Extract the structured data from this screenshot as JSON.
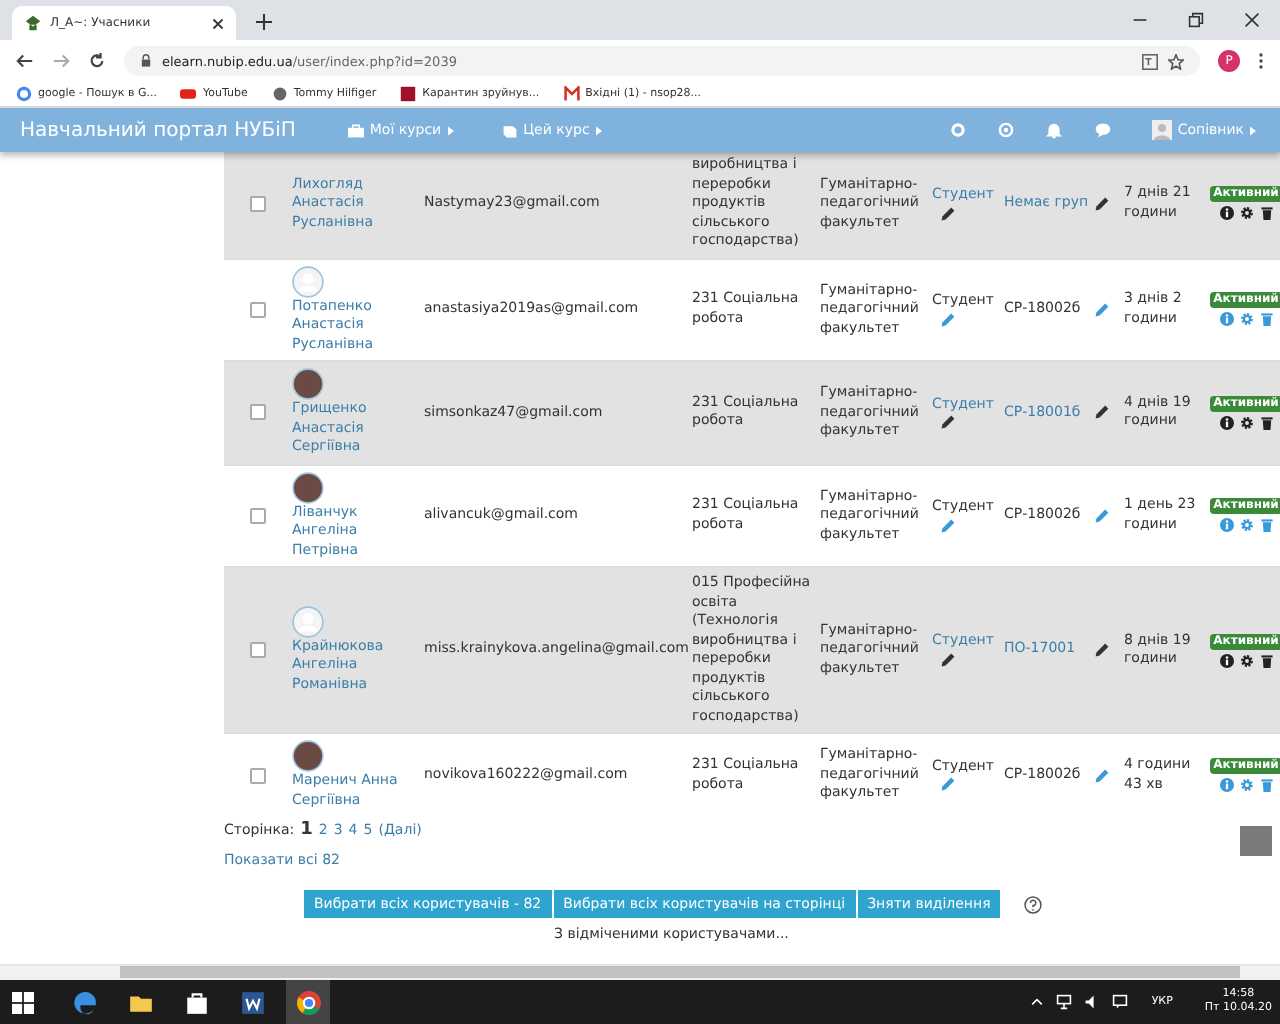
{
  "browser": {
    "tab_title": "Л_А~: Учасники",
    "url_host": "elearn.nubip.edu.ua",
    "url_path": "/user/index.php?id=2039",
    "avatar_letter": "P",
    "bookmarks": [
      {
        "label": "google - Пошук в G...",
        "kind": "google"
      },
      {
        "label": "YouTube",
        "kind": "youtube"
      },
      {
        "label": "Tommy Hilfiger",
        "kind": "globe"
      },
      {
        "label": "Карантин зруйнув...",
        "kind": "news"
      },
      {
        "label": "Вхідні (1) - nsop28...",
        "kind": "mail"
      }
    ]
  },
  "navbar": {
    "brand": "Навчальний портал НУБіП",
    "menus": [
      {
        "label": "Мої курси",
        "kind": "briefcase"
      },
      {
        "label": "Цей курс",
        "kind": "book"
      }
    ],
    "user": "Сопівник"
  },
  "rows": [
    {
      "name": "Лихогляд Анастасія Русланівна",
      "checked": false,
      "email": "Nastymay23@gmail.com",
      "specialty": "виробництва і переробки продуктів сільського господарства)",
      "faculty": "Гуманітарно- педагогічний факультет",
      "role": "Студент",
      "group": "Немає груп",
      "last_access": "7 днів 21 години",
      "status": "Активний"
    },
    {
      "name": "Потапенко Анастасія Русланівна",
      "kind": "default",
      "checked": false,
      "email": "anastasiya2019as@gmail.com",
      "specialty": "231 Соціальна робота",
      "faculty": "Гуманітарно- педагогічний факультет",
      "role": "Студент",
      "group": "СР-18002б",
      "last_access": "3 днів 2 години",
      "status": "Активний"
    },
    {
      "name": "Грищенко Анастасія Сергіївна",
      "kind": "photo",
      "checked": false,
      "email": "simsonkaz47@gmail.com",
      "specialty": "231 Соціальна робота",
      "faculty": "Гуманітарно- педагогічний факультет",
      "role": "Студент",
      "group": "СР-18001б",
      "last_access": "4 днів 19 години",
      "status": "Активний"
    },
    {
      "name": "Ліванчук Ангеліна Петрівна",
      "kind": "photo",
      "checked": false,
      "email": "alivancuk@gmail.com",
      "specialty": "231 Соціальна робота",
      "faculty": "Гуманітарно- педагогічний факультет",
      "role": "Студент",
      "group": "СР-18002б",
      "last_access": "1 день 23 години",
      "status": "Активний"
    },
    {
      "name": "Крайнюкова Ангеліна Романівна",
      "kind": "default",
      "checked": false,
      "email": "miss.krainykova.angelina@gmail.com",
      "specialty": "015 Професійна освіта (Технологія виробництва і переробки продуктів сільського господарства)",
      "faculty": "Гуманітарно- педагогічний факультет",
      "role": "Студент",
      "group": "ПО-17001",
      "last_access": "8 днів 19 години",
      "status": "Активний"
    },
    {
      "name": "Маренич Анна Сергіївна",
      "kind": "photo",
      "checked": false,
      "email": "novikova160222@gmail.com",
      "specialty": "231 Соціальна робота",
      "faculty": "Гуманітарно- педагогічний факультет",
      "role": "Студент",
      "group": "СР-18002б",
      "last_access": "4 години 43 хв",
      "status": "Активний"
    }
  ],
  "pagination": {
    "label": "Сторінка:",
    "pages": [
      {
        "label": "1",
        "selected": true
      },
      {
        "label": "2",
        "selected": false
      },
      {
        "label": "3",
        "selected": false
      },
      {
        "label": "4",
        "selected": false
      },
      {
        "label": "5",
        "selected": false
      }
    ],
    "next": "(Далі)"
  },
  "show_all": "Показати всі 82",
  "buttons": [
    "Вибрати всіх користувачів - 82",
    "Вибрати всіх користувачів на сторінці",
    "Зняти виділення"
  ],
  "with_selected": "З відміченими користувачами...",
  "taskbar": {
    "apps": [
      {
        "kind": "edge",
        "selected": false
      },
      {
        "kind": "folder",
        "selected": false
      },
      {
        "kind": "store",
        "selected": false
      },
      {
        "kind": "word",
        "selected": false
      },
      {
        "kind": "chrome",
        "selected": true
      }
    ],
    "lang": "УКР",
    "time": "14:58",
    "date": "Пт 10.04.20"
  }
}
